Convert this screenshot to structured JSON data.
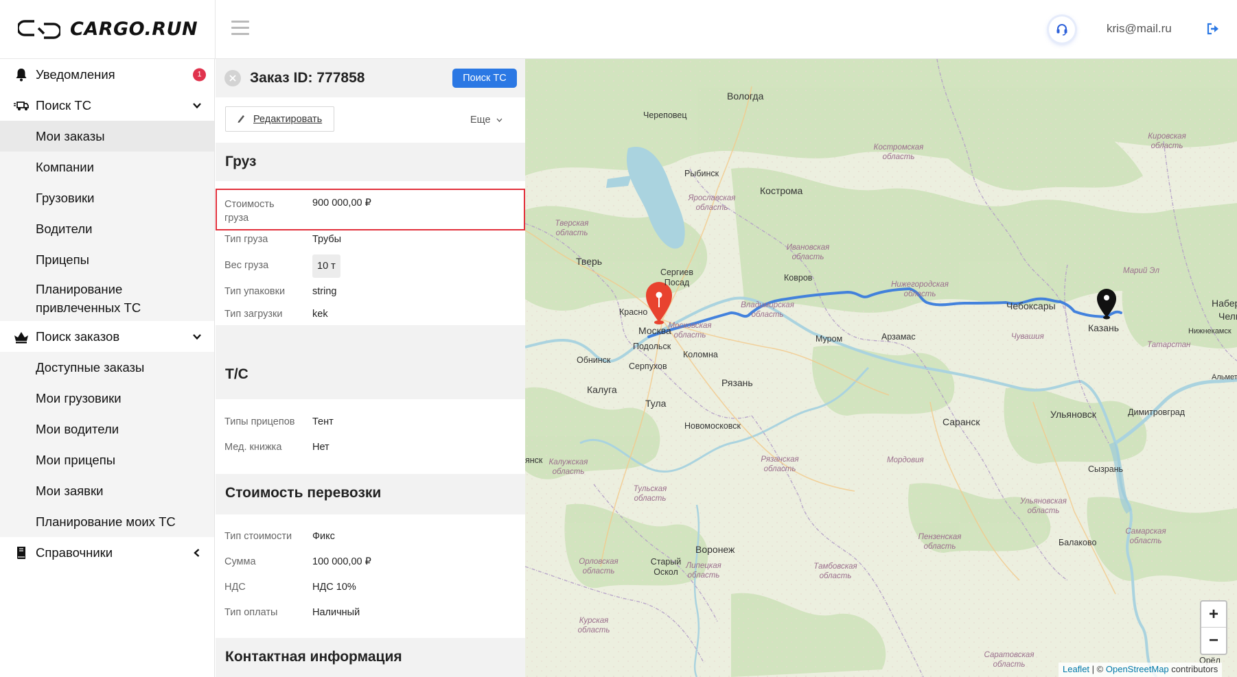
{
  "header": {
    "brand": "CARGO.RUN",
    "user_email": "kris@mail.ru"
  },
  "sidebar": {
    "notifications": {
      "label": "Уведомления",
      "count": "1"
    },
    "vehicle_search": {
      "label": "Поиск ТС",
      "items": [
        "Мои заказы",
        "Компании",
        "Грузовики",
        "Водители",
        "Прицепы",
        "Планирование привлеченных ТС"
      ]
    },
    "order_search": {
      "label": "Поиск заказов",
      "items": [
        "Доступные заказы",
        "Мои грузовики",
        "Мои водители",
        "Мои прицепы",
        "Мои заявки",
        "Планирование моих ТС"
      ]
    },
    "references": {
      "label": "Справочники"
    }
  },
  "order": {
    "title": "Заказ ID: 777858",
    "search_button": "Поиск ТС",
    "edit_label": "Редактировать",
    "more_label": "Еще",
    "cargo": {
      "heading": "Груз",
      "value_label": "Стоимость груза",
      "value": "900 000,00 ₽",
      "type_label": "Тип груза",
      "type": "Трубы",
      "weight_label": "Вес груза",
      "weight": "10 т",
      "packaging_label": "Тип упаковки",
      "packaging": "string",
      "loading_label": "Тип загрузки",
      "loading": "kek"
    },
    "vehicle": {
      "heading": "Т/С",
      "trailer_label": "Типы прицепов",
      "trailer": "Тент",
      "medbook_label": "Мед. книжка",
      "medbook": "Нет"
    },
    "cost": {
      "heading": "Стоимость перевозки",
      "cost_type_label": "Тип стоимости",
      "cost_type": "Фикс",
      "sum_label": "Сумма",
      "sum": "100 000,00 ₽",
      "vat_label": "НДС",
      "vat": "НДС 10%",
      "payment_label": "Тип оплаты",
      "payment": "Наличный"
    },
    "contacts": {
      "heading": "Контактная информация"
    }
  },
  "map": {
    "cities": [
      "Вологда",
      "Череповец",
      "Рыбинск",
      "Кострома",
      "Тверь",
      "Сергиев Посад",
      "Ковров",
      "Москва",
      "Подольск",
      "Обнинск",
      "Серпухов",
      "Коломна",
      "Муром",
      "Арзамас",
      "Чебоксары",
      "Казань",
      "Рязань",
      "Калуга",
      "Тула",
      "Новомосковск",
      "Саранск",
      "Ульяновск",
      "Димитровград",
      "Сызрань",
      "Балаково",
      "Воронеж",
      "Старый Оскол",
      "Орёл",
      "Набере",
      "Челн",
      "Нижнекамск",
      "Альметь",
      "Красно",
      "янск"
    ],
    "regions": [
      "Костромская область",
      "Кировская область",
      "Ярославская область",
      "Тверская область",
      "Ивановская область",
      "Нижегородская область",
      "Марий Эл",
      "Владимирская область",
      "Московская область",
      "Чувашия",
      "Татарстан",
      "Калужская область",
      "Рязанская область",
      "Мордовия",
      "Тульская область",
      "Ульяновская область",
      "Пензенская область",
      "Самарская область",
      "Орловская область",
      "Липецкая область",
      "Тамбовская область",
      "Курская область",
      "Саратовская область"
    ],
    "zoom_in": "+",
    "zoom_out": "−",
    "attribution": {
      "leaflet": "Leaflet",
      "sep": "| ©",
      "osm": "OpenStreetMap",
      "suffix": "contributors"
    },
    "route_color": "#3a7bdc",
    "start_marker_color": "#e8432f",
    "end_marker_color": "#111111"
  }
}
